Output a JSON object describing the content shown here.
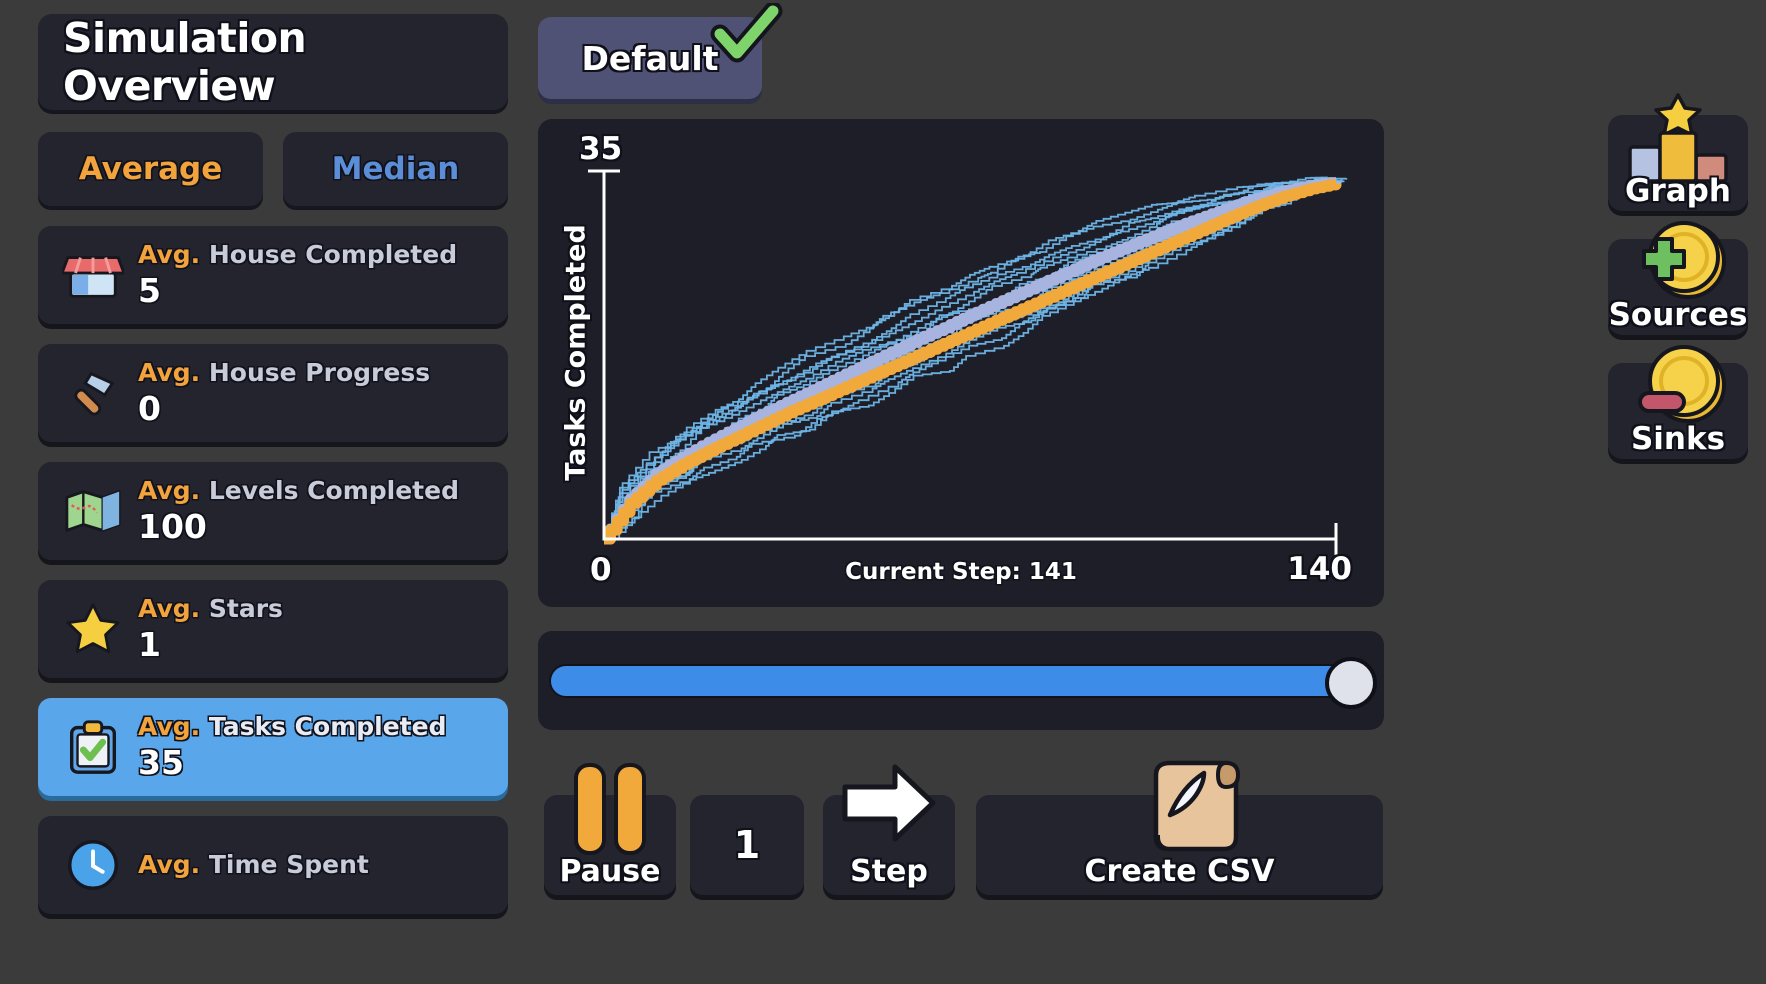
{
  "header": {
    "title": "Simulation Overview",
    "default_button": {
      "label": "Default",
      "check_icon": "green-check-icon"
    }
  },
  "mode_toggle": {
    "average_label": "Average",
    "median_label": "Median",
    "average_color": "#f2a33c",
    "median_color": "#5b8ed6"
  },
  "stats": [
    {
      "icon": "store-icon",
      "prefix": "Avg.",
      "label": "House Completed",
      "value": "5",
      "selected": false
    },
    {
      "icon": "hammer-icon",
      "prefix": "Avg.",
      "label": "House Progress",
      "value": "0",
      "selected": false
    },
    {
      "icon": "map-icon",
      "prefix": "Avg.",
      "label": "Levels Completed",
      "value": "100",
      "selected": false
    },
    {
      "icon": "star-icon",
      "prefix": "Avg.",
      "label": "Stars",
      "value": "1",
      "selected": false
    },
    {
      "icon": "clipboard-icon",
      "prefix": "Avg.",
      "label": "Tasks Completed",
      "value": "35",
      "selected": true
    },
    {
      "icon": "clock-icon",
      "prefix": "Avg.",
      "label": "Time Spent",
      "value": "",
      "selected": false
    }
  ],
  "chart_data": {
    "type": "line",
    "title": "",
    "xlabel": "",
    "ylabel": "Tasks Completed",
    "xlim": [
      0,
      140
    ],
    "ylim": [
      0,
      35
    ],
    "x_ticks": [
      "0",
      "140"
    ],
    "y_ticks": [
      "35"
    ],
    "grid": false,
    "legend": "none",
    "annotation": "Current Step: 141",
    "current_step": 141,
    "colors": {
      "average": "#f0a93a",
      "median": "#a8b4e0",
      "runs": "#6fb6e8",
      "axis": "#ffffff",
      "background": "#1e1e29"
    },
    "series": [
      {
        "name": "Average",
        "color": "#f0a93a",
        "x": [
          0,
          5,
          10,
          15,
          20,
          25,
          30,
          35,
          40,
          45,
          50,
          55,
          60,
          65,
          70,
          75,
          80,
          85,
          90,
          95,
          100,
          105,
          110,
          115,
          120,
          125,
          130,
          135,
          140
        ],
        "values": [
          0,
          3.4,
          5.6,
          7.1,
          8.4,
          9.6,
          10.8,
          12.0,
          13.1,
          14.2,
          15.3,
          16.4,
          17.5,
          18.6,
          19.7,
          20.8,
          21.9,
          23.0,
          24.1,
          25.2,
          26.3,
          27.4,
          28.5,
          29.6,
          30.7,
          31.7,
          32.6,
          33.3,
          33.8
        ]
      },
      {
        "name": "Median",
        "color": "#a8b4e0",
        "x": [
          0,
          5,
          10,
          15,
          20,
          25,
          30,
          35,
          40,
          45,
          50,
          55,
          60,
          65,
          70,
          75,
          80,
          85,
          90,
          95,
          100,
          105,
          110,
          115,
          120,
          125,
          130,
          135,
          140
        ],
        "values": [
          0,
          3.8,
          6.2,
          7.8,
          9.2,
          10.5,
          11.8,
          13.0,
          14.2,
          15.4,
          16.6,
          17.8,
          19.0,
          20.1,
          21.3,
          22.4,
          23.5,
          24.6,
          25.7,
          26.8,
          27.8,
          28.8,
          29.8,
          30.7,
          31.6,
          32.4,
          33.1,
          33.6,
          34.0
        ]
      }
    ],
    "run_band": {
      "name": "Individual runs",
      "color": "#6fb6e8",
      "count": 14,
      "spread": [
        0.0,
        1.6,
        2.1,
        2.5,
        2.8,
        3.0,
        3.2,
        3.4,
        3.5,
        3.6,
        3.7,
        3.7,
        3.8,
        3.8,
        3.8,
        3.7,
        3.6,
        3.5,
        3.4,
        3.2,
        3.0,
        2.7,
        2.4,
        2.1,
        1.7,
        1.3,
        0.9,
        0.5,
        0.2
      ]
    }
  },
  "slider": {
    "name": "timeline-slider",
    "value": 100,
    "min": 0,
    "max": 100,
    "fill_color": "#3d8ce8"
  },
  "controls": {
    "pause": {
      "label": "Pause",
      "icon": "pause-icon"
    },
    "speed": {
      "value": "1"
    },
    "step": {
      "label": "Step",
      "icon": "arrow-right-icon"
    },
    "csv": {
      "label": "Create CSV",
      "icon": "scroll-quill-icon"
    }
  },
  "right_rail": [
    {
      "label": "Graph",
      "icon": "podium-star-icon"
    },
    {
      "label": "Sources",
      "icon": "coin-plus-icon"
    },
    {
      "label": "Sinks",
      "icon": "coin-minus-icon"
    }
  ]
}
